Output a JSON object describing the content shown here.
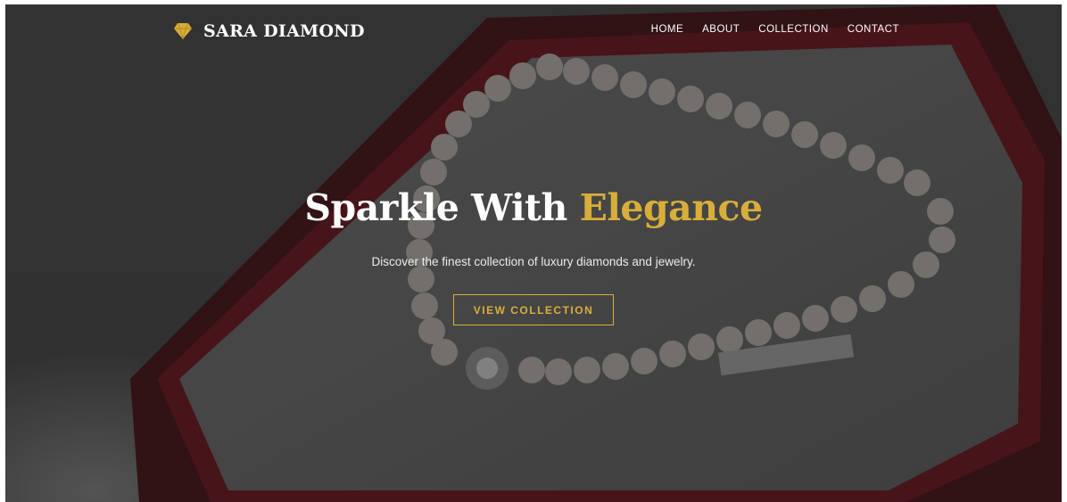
{
  "colors": {
    "accent": "#d8ae3a",
    "text": "#ffffff",
    "overlay": "#1a1a1a"
  },
  "brand": {
    "name": "SARA DIAMOND",
    "icon": "diamond-icon"
  },
  "nav": {
    "items": [
      "HOME",
      "ABOUT",
      "COLLECTION",
      "CONTACT"
    ]
  },
  "hero": {
    "title_main": "Sparkle With",
    "title_accent": "Elegance",
    "subtitle": "Discover the finest collection of luxury diamonds and jewelry.",
    "cta_label": "VIEW COLLECTION"
  }
}
